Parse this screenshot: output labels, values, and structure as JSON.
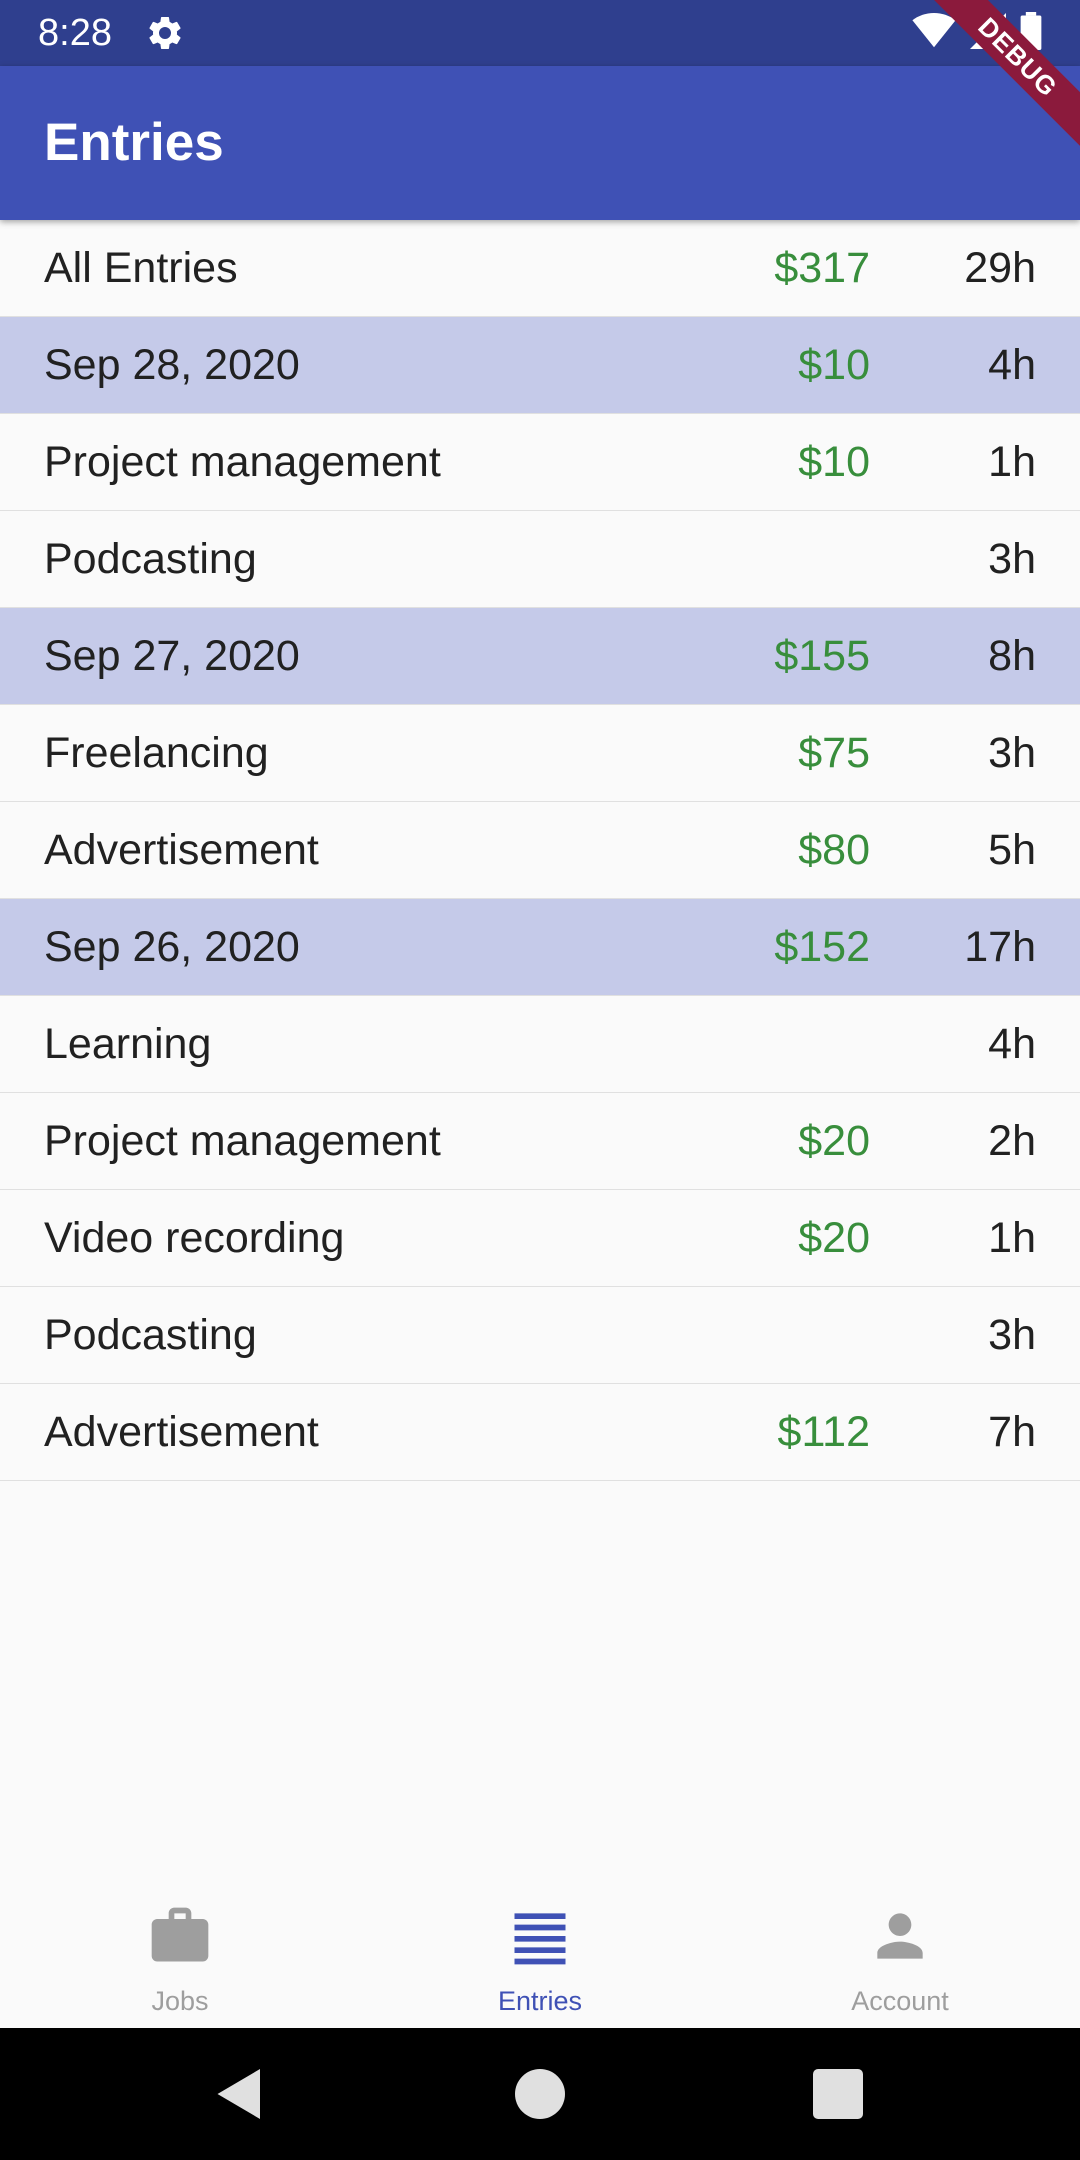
{
  "status_bar": {
    "time": "8:28",
    "icons": [
      "gear-icon",
      "wifi-icon",
      "signal-icon",
      "battery-icon"
    ]
  },
  "debug_banner": "DEBUG",
  "app_bar": {
    "title": "Entries"
  },
  "entries": [
    {
      "label": "All Entries",
      "amount": "$317",
      "hours": "29h",
      "type": "summary"
    },
    {
      "label": "Sep 28, 2020",
      "amount": "$10",
      "hours": "4h",
      "type": "date"
    },
    {
      "label": "Project management",
      "amount": "$10",
      "hours": "1h",
      "type": "job"
    },
    {
      "label": "Podcasting",
      "amount": "",
      "hours": "3h",
      "type": "job"
    },
    {
      "label": "Sep 27, 2020",
      "amount": "$155",
      "hours": "8h",
      "type": "date"
    },
    {
      "label": "Freelancing",
      "amount": "$75",
      "hours": "3h",
      "type": "job"
    },
    {
      "label": "Advertisement",
      "amount": "$80",
      "hours": "5h",
      "type": "job"
    },
    {
      "label": "Sep 26, 2020",
      "amount": "$152",
      "hours": "17h",
      "type": "date"
    },
    {
      "label": "Learning",
      "amount": "",
      "hours": "4h",
      "type": "job"
    },
    {
      "label": "Project management",
      "amount": "$20",
      "hours": "2h",
      "type": "job"
    },
    {
      "label": "Video recording",
      "amount": "$20",
      "hours": "1h",
      "type": "job"
    },
    {
      "label": "Podcasting",
      "amount": "",
      "hours": "3h",
      "type": "job"
    },
    {
      "label": "Advertisement",
      "amount": "$112",
      "hours": "7h",
      "type": "job"
    }
  ],
  "bottom_nav": {
    "jobs": {
      "label": "Jobs",
      "icon": "briefcase-icon"
    },
    "entries": {
      "label": "Entries",
      "icon": "list-icon"
    },
    "account": {
      "label": "Account",
      "icon": "person-icon"
    },
    "selected": "entries"
  },
  "colors": {
    "primary": "#3f51b5",
    "status_bar": "#2f3f8e",
    "date_row": "#c5cae9",
    "amount": "#388e3c",
    "debug": "#8b1a3c"
  }
}
